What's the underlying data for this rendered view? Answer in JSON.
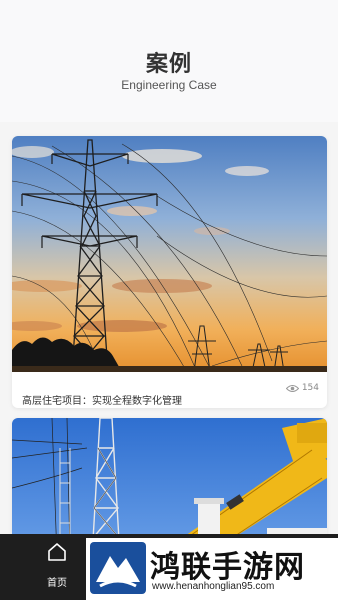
{
  "header": {
    "title": "案例",
    "subtitle": "Engineering Case"
  },
  "cases": [
    {
      "caption": "高层住宅项目：实现全程数字化管理",
      "views": "154",
      "image": "power-transmission-tower-sunset"
    },
    {
      "image": "power-tower-and-crane"
    }
  ],
  "tabbar": {
    "home_label": "首页",
    "home_icon": "home-icon"
  },
  "watermark": {
    "title": "鸿联手游网",
    "url": "www.henanhonglian95.com"
  },
  "colors": {
    "tabbar_bg": "#1e1e1e",
    "title": "#333333",
    "caption": "#333333",
    "watermark_logo": "#1a4f9c"
  }
}
